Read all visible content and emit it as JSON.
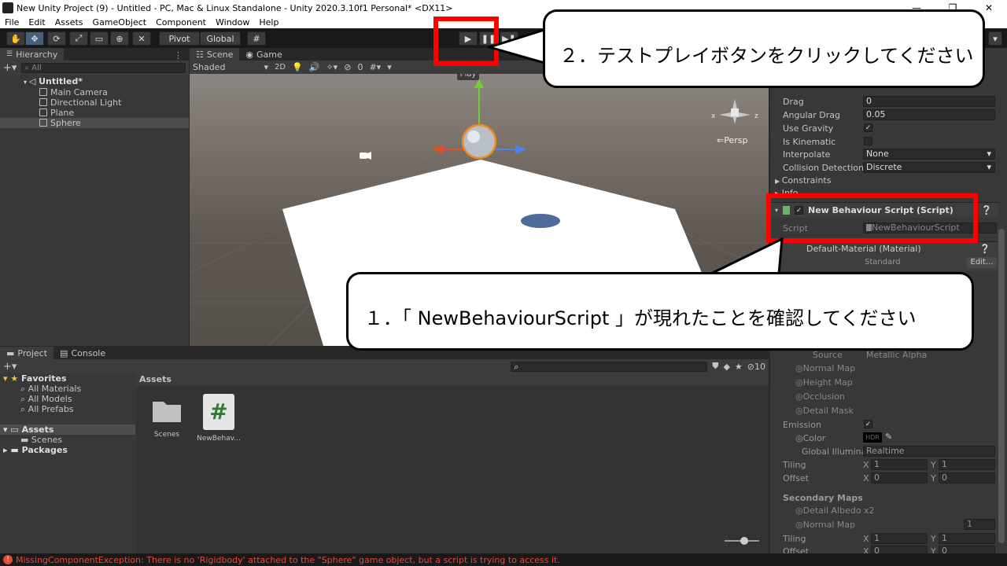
{
  "window": {
    "title": "New Unity Project (9) - Untitled - PC, Mac & Linux Standalone - Unity 2020.3.10f1 Personal* <DX11>",
    "controls": [
      "—",
      "❐",
      "✕"
    ]
  },
  "menu": [
    "File",
    "Edit",
    "Assets",
    "GameObject",
    "Component",
    "Window",
    "Help"
  ],
  "toolbar": {
    "pivot": "Pivot",
    "global": "Global",
    "play_tooltip": "Play"
  },
  "hierarchy": {
    "tab": "Hierarchy",
    "search_placeholder": "All",
    "scene": "Untitled*",
    "items": [
      "Main Camera",
      "Directional Light",
      "Plane",
      "Sphere"
    ]
  },
  "scene_view": {
    "tabs": [
      "Scene",
      "Game"
    ],
    "shading": "Shaded",
    "mode_2d": "2D",
    "gizmo_count": "0",
    "persp": "Persp"
  },
  "inspector": {
    "rigidbody": [
      {
        "label": "Drag",
        "value": "0"
      },
      {
        "label": "Angular Drag",
        "value": "0.05"
      }
    ],
    "use_gravity": "Use Gravity",
    "is_kinematic": "Is Kinematic",
    "interpolate": {
      "label": "Interpolate",
      "value": "None"
    },
    "collision": {
      "label": "Collision Detection",
      "value": "Discrete"
    },
    "constraints": "Constraints",
    "info": "Info",
    "script_component": {
      "title": "New Behaviour Script (Script)",
      "script_label": "Script",
      "script_value": "NewBehaviourScript"
    },
    "material": {
      "title": "Default-Material (Material)",
      "shader": "Standard",
      "edit": "Edit..."
    },
    "map_rows": [
      {
        "label": "Source",
        "value": "Metallic Alpha"
      },
      {
        "label": "Normal Map"
      },
      {
        "label": "Height Map"
      },
      {
        "label": "Occlusion"
      },
      {
        "label": "Detail Mask"
      }
    ],
    "emission": "Emission",
    "color": "Color",
    "hdr": "HDR",
    "global_illum": {
      "label": "Global Illuminati",
      "value": "Realtime"
    },
    "tiling": {
      "label": "Tiling",
      "x": "1",
      "y": "1"
    },
    "offset": {
      "label": "Offset",
      "x": "0",
      "y": "0"
    },
    "secondary": "Secondary Maps",
    "detail_albedo": "Detail Albedo x2",
    "sec_normal": {
      "label": "Normal Map",
      "value": "1"
    },
    "tiling2": {
      "label": "Tiling",
      "x": "1",
      "y": "1"
    },
    "offset2": {
      "label": "Offset",
      "x": "0",
      "y": "0"
    }
  },
  "project": {
    "tabs": [
      "Project",
      "Console"
    ],
    "hidden_count": "10",
    "favorites": "Favorites",
    "fav_items": [
      "All Materials",
      "All Models",
      "All Prefabs"
    ],
    "assets": "Assets",
    "asset_children": [
      "Scenes"
    ],
    "packages": "Packages",
    "breadcrumb": "Assets",
    "grid": [
      {
        "name": "Scenes",
        "kind": "folder"
      },
      {
        "name": "NewBehav...",
        "kind": "script"
      }
    ]
  },
  "status": {
    "message": "MissingComponentException: There is no 'Rigidbody' attached to the \"Sphere\" game object, but a script is trying to access it."
  },
  "callouts": {
    "step2": "２．テストプレイボタンをクリックしてください",
    "step1": "１．「 NewBehaviourScript 」が現れたことを確認してください"
  },
  "colors": {
    "highlight": "#ff0000",
    "selection": "#46607c",
    "error": "#e24a3a"
  }
}
